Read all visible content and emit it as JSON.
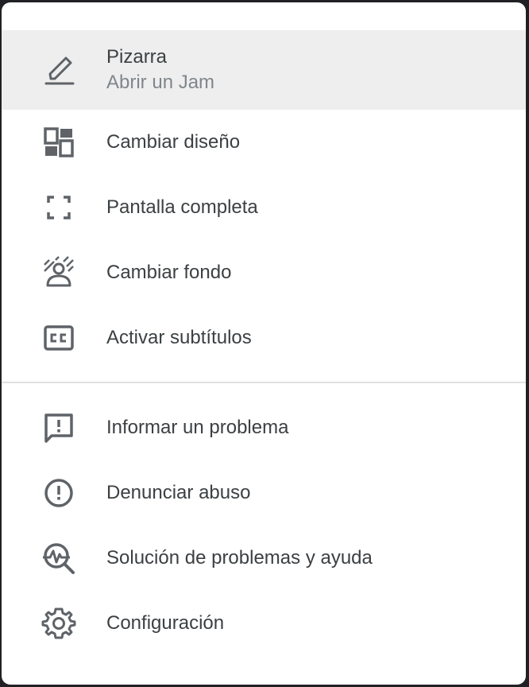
{
  "menu": {
    "items": [
      {
        "label": "Pizarra",
        "sublabel": "Abrir un Jam",
        "icon": "pen-icon"
      },
      {
        "label": "Cambiar diseño",
        "icon": "layout-icon"
      },
      {
        "label": "Pantalla completa",
        "icon": "fullscreen-icon"
      },
      {
        "label": "Cambiar fondo",
        "icon": "background-blur-icon"
      },
      {
        "label": "Activar subtítulos",
        "icon": "closed-captions-icon"
      },
      {
        "label": "Informar un problema",
        "icon": "feedback-icon"
      },
      {
        "label": "Denunciar abuso",
        "icon": "report-icon"
      },
      {
        "label": "Solución de problemas y ayuda",
        "icon": "troubleshoot-icon"
      },
      {
        "label": "Configuración",
        "icon": "settings-icon"
      }
    ]
  },
  "colors": {
    "text": "#3c4043",
    "secondary_text": "#80868b",
    "icon": "#5f6368",
    "highlight": "#eeeeee",
    "divider": "#e0e0e0"
  }
}
